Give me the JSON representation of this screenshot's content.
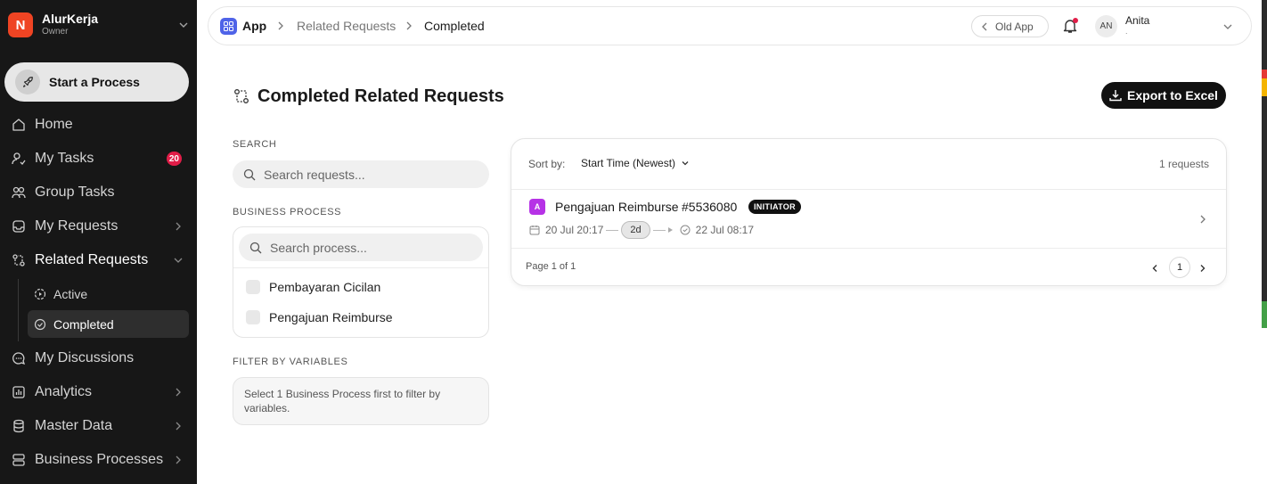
{
  "sidebar": {
    "org_initial": "N",
    "org_name": "AlurKerja",
    "org_role": "Owner",
    "start_process": "Start a Process",
    "items": {
      "home": "Home",
      "my_tasks": "My Tasks",
      "my_tasks_badge": "20",
      "group_tasks": "Group Tasks",
      "my_requests": "My Requests",
      "related_requests": "Related Requests",
      "active": "Active",
      "completed": "Completed",
      "my_discussions": "My Discussions",
      "analytics": "Analytics",
      "master_data": "Master Data",
      "business_processes": "Business Processes"
    }
  },
  "topbar": {
    "breadcrumb": [
      "App",
      "Related Requests",
      "Completed"
    ],
    "old_app": "Old App",
    "user_initials": "AN",
    "user_name": "Anita",
    "user_sub": "."
  },
  "main": {
    "title": "Completed Related Requests",
    "export_label": "Export to Excel",
    "search_label": "SEARCH",
    "search_placeholder": "Search requests...",
    "bp_label": "BUSINESS PROCESS",
    "bp_search_placeholder": "Search process...",
    "bp_options": [
      "Pembayaran Cicilan",
      "Pengajuan Reimburse"
    ],
    "filter_label": "FILTER BY VARIABLES",
    "filter_hint": "Select 1 Business Process first to filter by variables."
  },
  "list": {
    "sort_label": "Sort by:",
    "sort_value": "Start Time (Newest)",
    "count": "1 requests",
    "rows": [
      {
        "avatar": "A",
        "title": "Pengajuan Reimburse",
        "id": "#5536080",
        "badge": "INITIATOR",
        "start": "20 Jul 20:17",
        "duration": "2d",
        "end": "22 Jul 08:17"
      }
    ],
    "page_label": "Page 1 of 1",
    "current_page": "1"
  },
  "colors": {
    "sidebar_bg": "#171717",
    "brand_orange": "#ef4423",
    "app_icon_blue": "#4f63e8",
    "badge_red": "#e11d48",
    "avatar_purple": "#b632e6"
  }
}
